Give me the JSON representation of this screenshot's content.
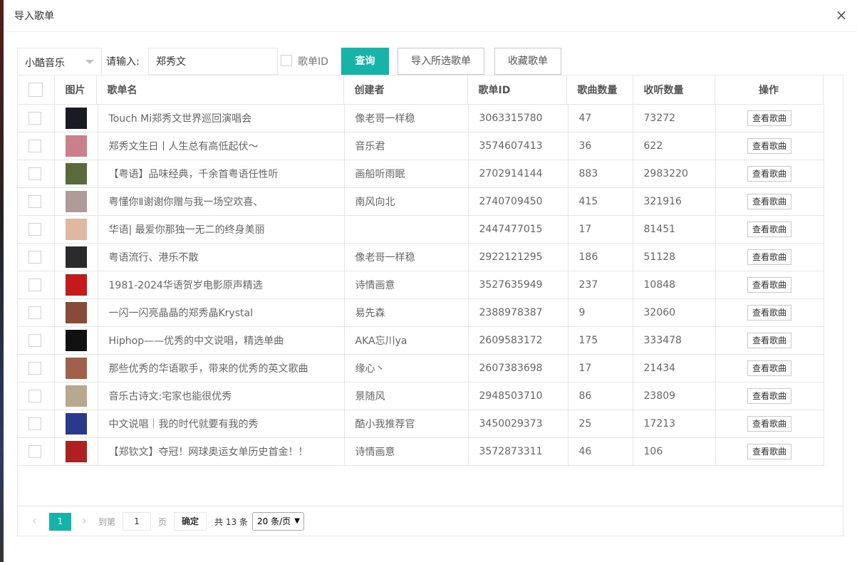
{
  "dialog": {
    "title": "导入歌单",
    "close_icon": "×"
  },
  "toolbar": {
    "source_value": "小酷音乐",
    "input_label": "请输入:",
    "search_value": "郑秀文",
    "playlist_id_label": "歌单ID",
    "query_label": "查询",
    "import_selected_label": "导入所选歌单",
    "favorite_label": "收藏歌单"
  },
  "accent_color": "#16b3a8",
  "table": {
    "headers": {
      "image": "图片",
      "name": "歌单名",
      "creator": "创建者",
      "id": "歌单ID",
      "song_count": "歌曲数量",
      "listen_count": "收听数量",
      "action": "操作"
    },
    "view_label": "查看歌曲",
    "rows": [
      {
        "name": "Touch Mi郑秀文世界巡回演唱会",
        "creator": "像老哥一样稳",
        "id": "3063315780",
        "songs": "47",
        "listens": "73272",
        "thumb": "#1a1a22"
      },
      {
        "name": "郑秀文生日丨人生总有高低起伏～",
        "creator": "音乐君",
        "id": "3574607413",
        "songs": "36",
        "listens": "622",
        "thumb": "#c9808a"
      },
      {
        "name": "【粤语】品味经典，千余首粤语任性听",
        "creator": "画船听雨眠",
        "id": "2702914144",
        "songs": "883",
        "listens": "2983220",
        "thumb": "#5a6a3a"
      },
      {
        "name": "粤懂你Ⅱ谢谢你赠与我一场空欢喜、",
        "creator": "南风向北",
        "id": "2740709450",
        "songs": "415",
        "listens": "321916",
        "thumb": "#b09a9a"
      },
      {
        "name": "华语| 最爱你那独一无二的终身美丽",
        "creator": "",
        "id": "2447477015",
        "songs": "17",
        "listens": "81451",
        "thumb": "#e0b8a0"
      },
      {
        "name": "粤语流行、港乐不散",
        "creator": "像老哥一样稳",
        "id": "2922121295",
        "songs": "186",
        "listens": "51128",
        "thumb": "#2a2a2a"
      },
      {
        "name": "1981-2024华语贺岁电影原声精选",
        "creator": "诗情画意",
        "id": "3527635949",
        "songs": "237",
        "listens": "10848",
        "thumb": "#c41a1a"
      },
      {
        "name": "一闪一闪亮晶晶的郑秀晶Krystal",
        "creator": "易先森",
        "id": "2388978387",
        "songs": "9",
        "listens": "32060",
        "thumb": "#8a4a3a"
      },
      {
        "name": "Hiphop——优秀的中文说唱，精选单曲",
        "creator": "AKA忘川ya",
        "id": "2609583172",
        "songs": "175",
        "listens": "333478",
        "thumb": "#111111"
      },
      {
        "name": "那些优秀的华语歌手，带来的优秀的英文歌曲",
        "creator": "缘心丶",
        "id": "2607383698",
        "songs": "17",
        "listens": "21434",
        "thumb": "#a0604a"
      },
      {
        "name": "音乐古诗文:宅家也能很优秀",
        "creator": "景随风",
        "id": "2948503710",
        "songs": "86",
        "listens": "23809",
        "thumb": "#b8a890"
      },
      {
        "name": "中文说唱｜我的时代就要有我的秀",
        "creator": "酷小我推荐官",
        "id": "3450029373",
        "songs": "25",
        "listens": "17213",
        "thumb": "#2a3a8a"
      },
      {
        "name": "【郑钦文】夺冠！网球奥运女单历史首金！！",
        "creator": "诗情画意",
        "id": "3572873311",
        "songs": "46",
        "listens": "106",
        "thumb": "#b02020"
      }
    ]
  },
  "pager": {
    "prev_icon": "‹",
    "next_icon": "›",
    "current_page": "1",
    "goto_label": "到第",
    "goto_value": "1",
    "page_unit": "页",
    "confirm_label": "确定",
    "total_text": "共 13 条",
    "page_size": "20 条/页"
  }
}
